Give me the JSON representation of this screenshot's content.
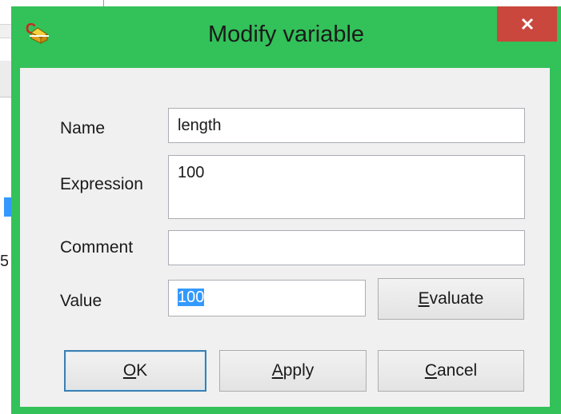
{
  "dialog": {
    "title": "Modify variable",
    "close_icon": "close-icon",
    "app_icon": "cad-app-icon"
  },
  "form": {
    "name_label": "Name",
    "name_value": "length",
    "expression_label": "Expression",
    "expression_value": "100",
    "comment_label": "Comment",
    "comment_value": "",
    "value_label": "Value",
    "value_value": "100"
  },
  "buttons": {
    "evaluate": {
      "mnemonic": "E",
      "rest": "valuate"
    },
    "ok": {
      "mnemonic": "O",
      "rest": "K"
    },
    "apply": {
      "mnemonic": "A",
      "rest": "pply"
    },
    "cancel": {
      "mnemonic": "C",
      "rest": "ancel"
    }
  },
  "background": {
    "partial_char": "5"
  },
  "colors": {
    "titlebar": "#33c159",
    "close_button": "#c9473d",
    "selection": "#3399ff",
    "default_button_border": "#3c7fb1"
  }
}
